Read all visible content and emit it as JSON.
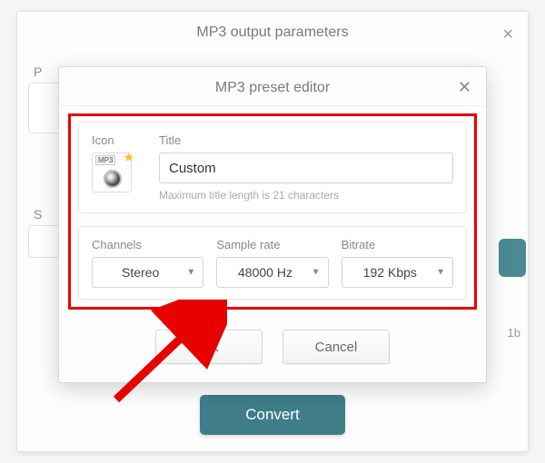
{
  "outer": {
    "title": "MP3 output parameters",
    "hint_p": "P",
    "hint_s": "S",
    "mb_hint": "1b",
    "convert_label": "Convert"
  },
  "modal": {
    "title": "MP3 preset editor",
    "icon_label": "Icon",
    "icon_badge": "MP3",
    "title_label": "Title",
    "title_value": "Custom",
    "title_helper": "Maximum title length is 21 characters",
    "channels_label": "Channels",
    "channels_value": "Stereo",
    "sample_label": "Sample rate",
    "sample_value": "48000 Hz",
    "bitrate_label": "Bitrate",
    "bitrate_value": "192 Kbps",
    "ok_label": "OK",
    "cancel_label": "Cancel"
  }
}
